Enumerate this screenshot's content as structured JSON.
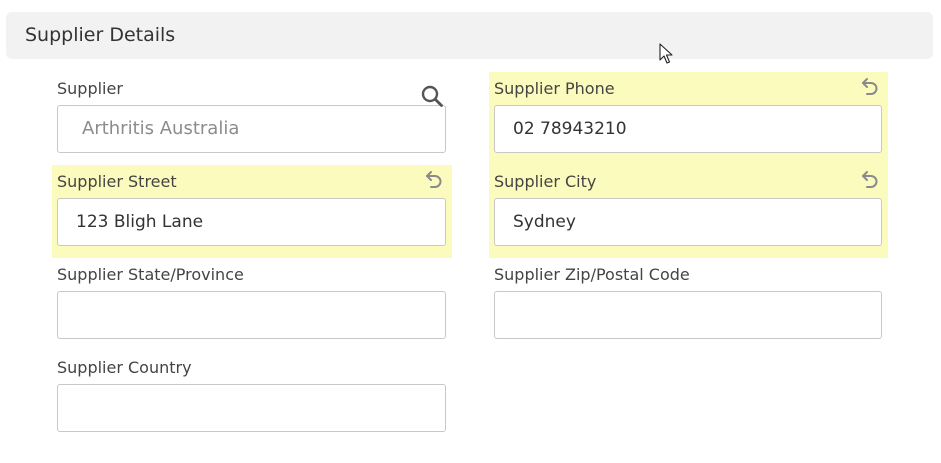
{
  "section": {
    "title": "Supplier Details"
  },
  "fields": {
    "supplier": {
      "label": "Supplier",
      "value": "Arthritis Australia",
      "icon": "search-icon"
    },
    "phone": {
      "label": "Supplier Phone",
      "value": "02 78943210",
      "icon": "undo-icon"
    },
    "street": {
      "label": "Supplier Street",
      "value": "123 Bligh Lane",
      "icon": "undo-icon"
    },
    "city": {
      "label": "Supplier City",
      "value": "Sydney",
      "icon": "undo-icon"
    },
    "state": {
      "label": "Supplier State/Province",
      "value": ""
    },
    "zip": {
      "label": "Supplier Zip/Postal Code",
      "value": ""
    },
    "country": {
      "label": "Supplier Country",
      "value": ""
    }
  },
  "colors": {
    "changed_highlight": "#fbfbbd",
    "header_bg": "#f2f2f2",
    "input_border": "#c8c8c8"
  }
}
